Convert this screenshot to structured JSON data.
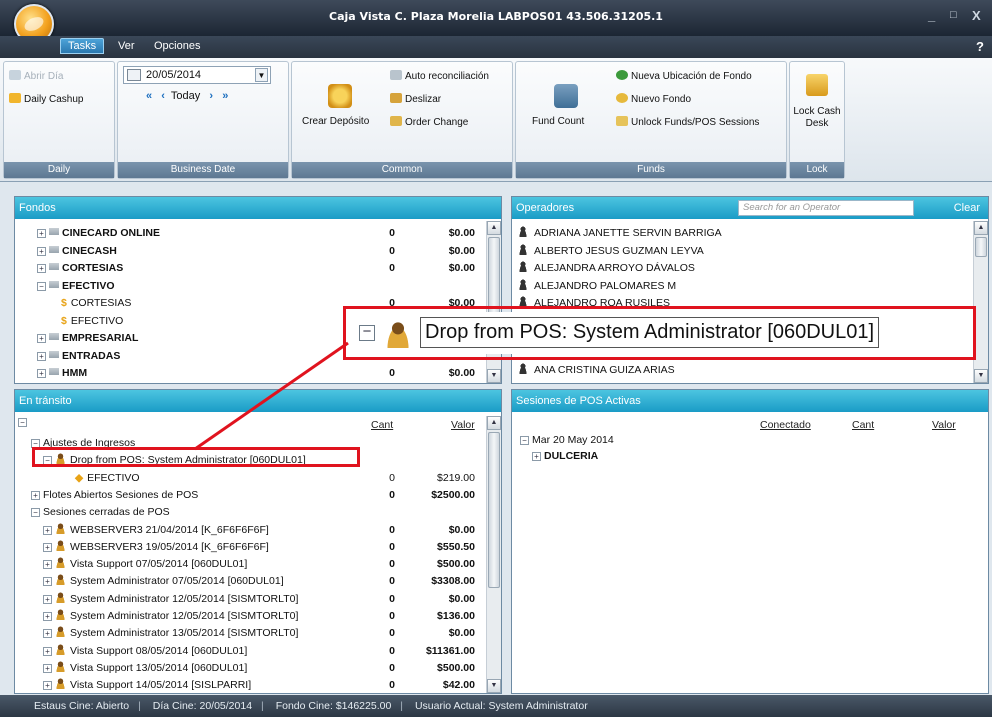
{
  "window": {
    "title": "Caja Vista   C. Plaza Morelia   LABPOS01   43.506.31205.1",
    "controls": [
      "_",
      "□",
      "X"
    ]
  },
  "menu": {
    "tasks": "Tasks",
    "ver": "Ver",
    "opciones": "Opciones",
    "help": "?"
  },
  "ribbon": {
    "daily": {
      "label": "Daily",
      "abrir_dia": "Abrir Día",
      "daily_cashup": "Daily Cashup"
    },
    "business_date": {
      "label": "Business Date",
      "date": "20/05/2014",
      "today": "Today",
      "nav_prev2": "«",
      "nav_prev": "‹",
      "nav_next": "›",
      "nav_next2": "»"
    },
    "common": {
      "label": "Common",
      "auto_reconciliacion": "Auto reconciliación",
      "deslizar": "Deslizar",
      "crear_deposito": "Crear Depósito",
      "order_change": "Order Change"
    },
    "funds": {
      "label": "Funds",
      "nueva_ubicacion": "Nueva Ubicación de Fondo",
      "nuevo_fondo": "Nuevo Fondo",
      "fund_count": "Fund Count",
      "unlock_funds": "Unlock Funds/POS Sessions"
    },
    "lock": {
      "label": "Lock",
      "lock_cash_desk_line1": "Lock Cash",
      "lock_cash_desk_line2": "Desk"
    }
  },
  "fondos": {
    "title": "Fondos",
    "rows": [
      {
        "name": "CINECARD ONLINE",
        "cant": "0",
        "valor": "$0.00",
        "level": 0,
        "expand": "+",
        "bold": true
      },
      {
        "name": "CINECASH",
        "cant": "0",
        "valor": "$0.00",
        "level": 0,
        "expand": "+",
        "bold": true
      },
      {
        "name": "CORTESIAS",
        "cant": "0",
        "valor": "$0.00",
        "level": 0,
        "expand": "+",
        "bold": true
      },
      {
        "name": "EFECTIVO",
        "cant": "",
        "valor": "",
        "level": 0,
        "expand": "−",
        "bold": true
      },
      {
        "name": "CORTESIAS",
        "cant": "0",
        "valor": "$0.00",
        "level": 1,
        "expand": "",
        "bold": false
      },
      {
        "name": "EFECTIVO",
        "cant": "",
        "valor": "",
        "level": 1,
        "expand": "",
        "bold": false
      },
      {
        "name": "EMPRESARIAL",
        "cant": "",
        "valor": "",
        "level": 0,
        "expand": "+",
        "bold": true
      },
      {
        "name": "ENTRADAS",
        "cant": "",
        "valor": "",
        "level": 0,
        "expand": "+",
        "bold": true
      },
      {
        "name": "HMM",
        "cant": "0",
        "valor": "$0.00",
        "level": 0,
        "expand": "+",
        "bold": true
      }
    ]
  },
  "operadores": {
    "title": "Operadores",
    "search_placeholder": "Search for an Operator",
    "clear": "Clear",
    "rows": [
      "ADRIANA JANETTE SERVIN BARRIGA",
      "ALBERTO JESUS GUZMAN LEYVA",
      "ALEJANDRA ARROYO DÁVALOS",
      "ALEJANDRO PALOMARES M",
      "ALEJANDRO ROA RUSILES",
      "ANA CRISTINA GUIZA ARIAS"
    ]
  },
  "zoom_callout": {
    "text": "Drop from POS: System Administrator [060DUL01]"
  },
  "en_transito": {
    "title": "En tránsito",
    "col_cant": "Cant",
    "col_valor": "Valor",
    "rows": [
      {
        "name": "Ajustes de Ingresos",
        "cant": "",
        "valor": "",
        "level": 0,
        "expand": "−",
        "icon": "none",
        "bold": false
      },
      {
        "name": "Drop from POS: System Administrator [060DUL01]",
        "cant": "",
        "valor": "",
        "level": 1,
        "expand": "−",
        "icon": "cash",
        "bold": false
      },
      {
        "name": "EFECTIVO",
        "cant": "0",
        "valor": "$219.00",
        "level": 2,
        "expand": "",
        "icon": "coin",
        "bold": false
      },
      {
        "name": "Flotes Abiertos Sesiones de POS",
        "cant": "0",
        "valor": "$2500.00",
        "level": 0,
        "expand": "+",
        "icon": "none",
        "bold": true
      },
      {
        "name": "Sesiones cerradas de POS",
        "cant": "",
        "valor": "",
        "level": 0,
        "expand": "−",
        "icon": "none",
        "bold": false
      },
      {
        "name": "WEBSERVER3 21/04/2014 [K_6F6F6F6F]",
        "cant": "0",
        "valor": "$0.00",
        "level": 1,
        "expand": "+",
        "icon": "cash",
        "bold": true
      },
      {
        "name": "WEBSERVER3 19/05/2014 [K_6F6F6F6F]",
        "cant": "0",
        "valor": "$550.50",
        "level": 1,
        "expand": "+",
        "icon": "cash",
        "bold": true
      },
      {
        "name": "Vista Support 07/05/2014 [060DUL01]",
        "cant": "0",
        "valor": "$500.00",
        "level": 1,
        "expand": "+",
        "icon": "cash",
        "bold": true
      },
      {
        "name": "System Administrator 07/05/2014 [060DUL01]",
        "cant": "0",
        "valor": "$3308.00",
        "level": 1,
        "expand": "+",
        "icon": "cash",
        "bold": true
      },
      {
        "name": "System Administrator 12/05/2014 [SISMTORLT0]",
        "cant": "0",
        "valor": "$0.00",
        "level": 1,
        "expand": "+",
        "icon": "cash",
        "bold": true
      },
      {
        "name": "System Administrator 12/05/2014 [SISMTORLT0]",
        "cant": "0",
        "valor": "$136.00",
        "level": 1,
        "expand": "+",
        "icon": "cash",
        "bold": true
      },
      {
        "name": "System Administrator 13/05/2014 [SISMTORLT0]",
        "cant": "0",
        "valor": "$0.00",
        "level": 1,
        "expand": "+",
        "icon": "cash",
        "bold": true
      },
      {
        "name": "Vista Support 08/05/2014 [060DUL01]",
        "cant": "0",
        "valor": "$11361.00",
        "level": 1,
        "expand": "+",
        "icon": "cash",
        "bold": true
      },
      {
        "name": "Vista Support 13/05/2014 [060DUL01]",
        "cant": "0",
        "valor": "$500.00",
        "level": 1,
        "expand": "+",
        "icon": "cash",
        "bold": true
      },
      {
        "name": "Vista Support 14/05/2014 [SISLPARRI]",
        "cant": "0",
        "valor": "$42.00",
        "level": 1,
        "expand": "+",
        "icon": "cash",
        "bold": true
      }
    ]
  },
  "sesiones": {
    "title": "Sesiones de POS Activas",
    "col_conectado": "Conectado",
    "col_cant": "Cant",
    "col_valor": "Valor",
    "rows": [
      {
        "name": "Mar 20 May 2014",
        "level": 0,
        "expand": "−",
        "bold": false
      },
      {
        "name": "DULCERIA",
        "level": 1,
        "expand": "+",
        "bold": true
      }
    ]
  },
  "status": {
    "estado": "Estaus Cine: Abierto",
    "dia": "Día Cine: 20/05/2014",
    "fondo": "Fondo Cine: $146225.00",
    "usuario": "Usuario Actual: System Administrator"
  },
  "colors": {
    "panel_header": "#1a9bc6",
    "highlight": "#e0131e"
  }
}
